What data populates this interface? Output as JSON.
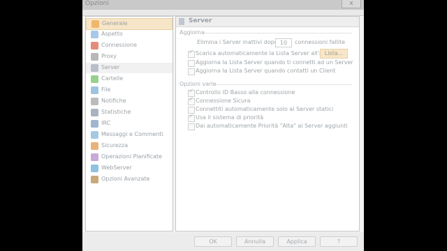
{
  "window": {
    "title": "Opzioni",
    "close_label": "x"
  },
  "sidebar": {
    "items": [
      {
        "label": "Generale",
        "icon": "gear-icon",
        "color": "#f2b66b"
      },
      {
        "label": "Aspetto",
        "icon": "brush-icon",
        "color": "#a8c8e8"
      },
      {
        "label": "Connessione",
        "icon": "connection-icon",
        "color": "#e48b7a"
      },
      {
        "label": "Proxy",
        "icon": "proxy-icon",
        "color": "#b8b8b8"
      },
      {
        "label": "Server",
        "icon": "server-icon",
        "color": "#b8bfc8"
      },
      {
        "label": "Cartelle",
        "icon": "folder-icon",
        "color": "#98d08e"
      },
      {
        "label": "File",
        "icon": "file-icon",
        "color": "#9ec4e0"
      },
      {
        "label": "Notifiche",
        "icon": "bell-icon",
        "color": "#bcbcbc"
      },
      {
        "label": "Statistiche",
        "icon": "stats-icon",
        "color": "#a9b4c0"
      },
      {
        "label": "IRC",
        "icon": "irc-icon",
        "color": "#9fb6cf"
      },
      {
        "label": "Messaggi e Commenti",
        "icon": "chat-icon",
        "color": "#a6c9e2"
      },
      {
        "label": "Sicurezza",
        "icon": "shield-icon",
        "color": "#e8b37a"
      },
      {
        "label": "Operazioni Pianificate",
        "icon": "clock-icon",
        "color": "#c9a9d8"
      },
      {
        "label": "WebServer",
        "icon": "globe-icon",
        "color": "#8fc3e0"
      },
      {
        "label": "Opzioni Avanzate",
        "icon": "advanced-icon",
        "color": "#c9a87a"
      }
    ]
  },
  "panel": {
    "title": "Server",
    "aggiorna": {
      "legend": "Aggiorna",
      "remove_prefix": "Elimina i Server inattivi dopo",
      "remove_value": "10",
      "remove_suffix": "connessioni fallite",
      "auto_download": "Scarica automaticamente la Lista Server all'avvio",
      "list_button": "Lista...",
      "update_on_connect": "Aggiorna la Lista Server quando ti connetti ad un Server",
      "update_on_client": "Aggiorna la Lista Server quando contatti un Client"
    },
    "opzioni": {
      "legend": "Opzioni varie",
      "low_id": "Controllo ID Basso alla connessione",
      "secure": "Connessione Sicura",
      "static": "Connettiti automaticamente solo ai Server statici",
      "priority": "Usa il sistema di priorità",
      "high_priority": "Dai automaticamente Priorità \"Alta\" ai Server aggiunti"
    }
  },
  "buttons": {
    "ok": "OK",
    "cancel": "Annulla",
    "apply": "Applica",
    "help": "?"
  }
}
